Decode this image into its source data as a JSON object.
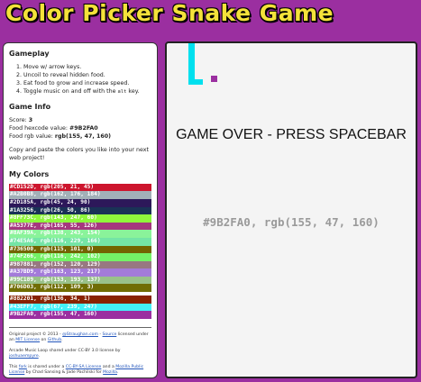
{
  "title": "Color Picker Snake Game",
  "sidebar": {
    "gameplay_heading": "Gameplay",
    "instructions": [
      "Move w/ arrow keys.",
      "Uncoil to reveal hidden food.",
      "Eat food to grow and increase speed.",
      "Toggle music on and off with the"
    ],
    "music_key": "alt",
    "music_key_suffix": " key.",
    "info_heading": "Game Info",
    "score_label": "Score: ",
    "score_value": "3",
    "hex_label": "Food hexcode value: ",
    "hex_value": "#9B2FA0",
    "rgb_label": "Food rgb value: ",
    "rgb_value": "rgb(155, 47, 160)",
    "copy_note": "Copy and paste the colors you like into your next web project!",
    "colors_heading": "My Colors",
    "swatches": [
      {
        "text": "#CD152D, rgb(205, 21, 45)",
        "color": "#CD152D",
        "fg": "#ffffff"
      },
      {
        "text": "#A2B0B8, rgb(162, 176, 184)",
        "color": "#A2B0B8",
        "fg": "#ffffff"
      },
      {
        "text": "#2D185A, rgb(45, 24, 90)",
        "color": "#2D185A",
        "fg": "#ffffff"
      },
      {
        "text": "#1A3256, rgb(26, 50, 86)",
        "color": "#1A3256",
        "fg": "#ffffff"
      },
      {
        "text": "#8FF73C, rgb(143, 247, 60)",
        "color": "#8FF73C",
        "fg": "#ffffff"
      },
      {
        "text": "#A5377E, rgb(165, 55, 126)",
        "color": "#A5377E",
        "fg": "#ffffff"
      },
      {
        "text": "#8AF39A, rgb(138, 243, 154)",
        "color": "#8AF39A",
        "fg": "#ffffff"
      },
      {
        "text": "#74E5A6, rgb(116, 229, 166)",
        "color": "#74E5A6",
        "fg": "#ffffff"
      },
      {
        "text": "#736500, rgb(115, 101, 0)",
        "color": "#736500",
        "fg": "#ffffff"
      },
      {
        "text": "#74F266, rgb(116, 242, 102)",
        "color": "#74F266",
        "fg": "#ffffff"
      },
      {
        "text": "#987881, rgb(152, 120, 129)",
        "color": "#987881",
        "fg": "#ffffff"
      },
      {
        "text": "#A37BD9, rgb(163, 123, 217)",
        "color": "#A37BD9",
        "fg": "#ffffff"
      },
      {
        "text": "#99C189, rgb(153, 193, 137)",
        "color": "#99C189",
        "fg": "#ffffff"
      },
      {
        "text": "#706D03, rgb(112, 109, 3)",
        "color": "#706D03",
        "fg": "#ffffff"
      },
      {
        "text": "",
        "color": "#ffffff",
        "fg": "#ffffff"
      },
      {
        "text": "#882201, rgb(136, 34, 1)",
        "color": "#882201",
        "fg": "#ffffff"
      },
      {
        "text": "#43EFF7, rgb(67, 239, 247)",
        "color": "#43EFF7",
        "fg": "#ffffff"
      },
      {
        "text": "#9B2FA0, rgb(155, 47, 160)",
        "color": "#9B2FA0",
        "fg": "#ffffff"
      }
    ],
    "footer": {
      "p1_a": "Original project © 2013 - ",
      "p1_link1": "@Straughan.com",
      "p1_b": " - ",
      "p1_link2": "Source",
      "p1_c": " licensed under an ",
      "p1_link3": "MIT License",
      "p1_d": " on ",
      "p1_link4": "Github",
      "p1_e": ".",
      "p2_a": "Arcade Music Loop shared under CC-BY 3.0 license by ",
      "p2_link1": "joshuaempyre",
      "p2_b": ".",
      "p3_a": "This ",
      "p3_link1": "fork",
      "p3_b": " is shared under a ",
      "p3_link2": "CC-BY-SA License",
      "p3_c": " and a ",
      "p3_link3": "Mozilla Public License",
      "p3_d": " by Chad Sansing & Jade Pachilski for ",
      "p3_link4": "Mozilla",
      "p3_e": "."
    }
  },
  "game": {
    "status_text": "GAME OVER - PRESS SPACEBAR",
    "color_readout": "#9B2FA0, rgb(155, 47, 160)",
    "snake_color": "#00E0EE",
    "food_color": "#9B2FA0",
    "background": "#F4F4F4"
  }
}
